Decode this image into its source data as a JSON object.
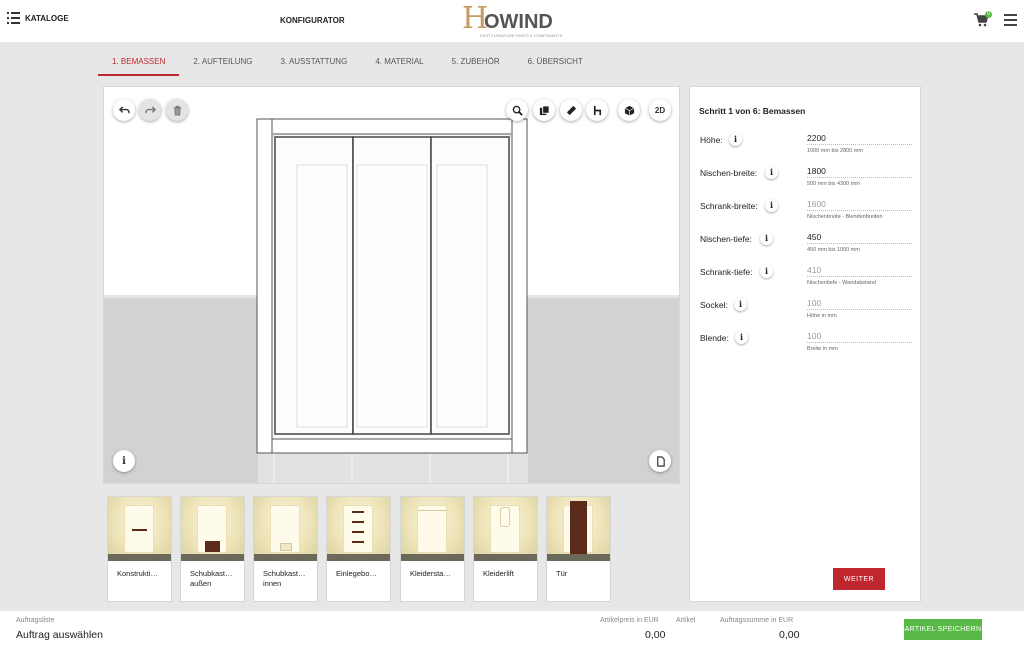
{
  "header": {
    "kataloge_label": "KATALOGE",
    "title": "KONFIGURATOR",
    "logo": {
      "initial": "H",
      "rest": "OWIND",
      "tagline": "EAST FURNITURE PARTS & COMPONENTS"
    },
    "cart_count": "0"
  },
  "steps": [
    {
      "label": "1. BEMASSEN",
      "active": true
    },
    {
      "label": "2. AUFTEILUNG",
      "active": false
    },
    {
      "label": "3. AUSSTATTUNG",
      "active": false
    },
    {
      "label": "4. MATERIAL",
      "active": false
    },
    {
      "label": "5. ZUBEHÖR",
      "active": false
    },
    {
      "label": "6. ÜBERSICHT",
      "active": false
    }
  ],
  "viewport": {
    "toolbar_2d_label": "2D",
    "icons": [
      "undo-icon",
      "redo-icon",
      "trash-icon",
      "zoom-icon",
      "copy-icon",
      "ruler-icon",
      "chair-icon",
      "cube-icon",
      "info-icon",
      "document-icon"
    ]
  },
  "panel": {
    "title": "Schritt 1 von 6: Bemassen",
    "fields": [
      {
        "label": "Höhe:",
        "value": "2200",
        "hint": "1000 mm bis 2800 mm",
        "readonly": false
      },
      {
        "label": "Nischen-breite:",
        "value": "1800",
        "hint": "500 mm bis 4300 mm",
        "readonly": false
      },
      {
        "label": "Schrank-breite:",
        "value": "1600",
        "hint": "Nischenbreite - Blendenbreiten",
        "readonly": true
      },
      {
        "label": "Nischen-tiefe:",
        "value": "450",
        "hint": "450 mm bis 1000 mm",
        "readonly": false
      },
      {
        "label": "Schrank-tiefe:",
        "value": "410",
        "hint": "Nischentiefe - Wandabstand",
        "readonly": true
      },
      {
        "label": "Sockel:",
        "value": "100",
        "hint": "Höhe in mm",
        "readonly": true
      },
      {
        "label": "Blende:",
        "value": "100",
        "hint": "Breite in mm",
        "readonly": true
      }
    ],
    "next_button": "WEITER"
  },
  "thumbnails": [
    {
      "label": "Konstrukti…"
    },
    {
      "label": "Schubkast… außen"
    },
    {
      "label": "Schubkast… innen"
    },
    {
      "label": "Einlegebo…"
    },
    {
      "label": "Kleidersta…"
    },
    {
      "label": "Kleiderlift"
    },
    {
      "label": "Tür"
    }
  ],
  "footer": {
    "order_list_label": "Auftragsliste",
    "order_select": "Auftrag auswählen",
    "article_price_label": "Artikelpreis in EUR",
    "article_price": "0,00",
    "article_label": "Artikel",
    "order_sum_label": "Auftragssumme in EUR",
    "order_sum": "0,00",
    "save_button": "ARTIKEL SPEICHERN"
  },
  "colors": {
    "accent_red": "#c0262d",
    "accent_green": "#58b947",
    "logo_gold": "#c89a63"
  }
}
